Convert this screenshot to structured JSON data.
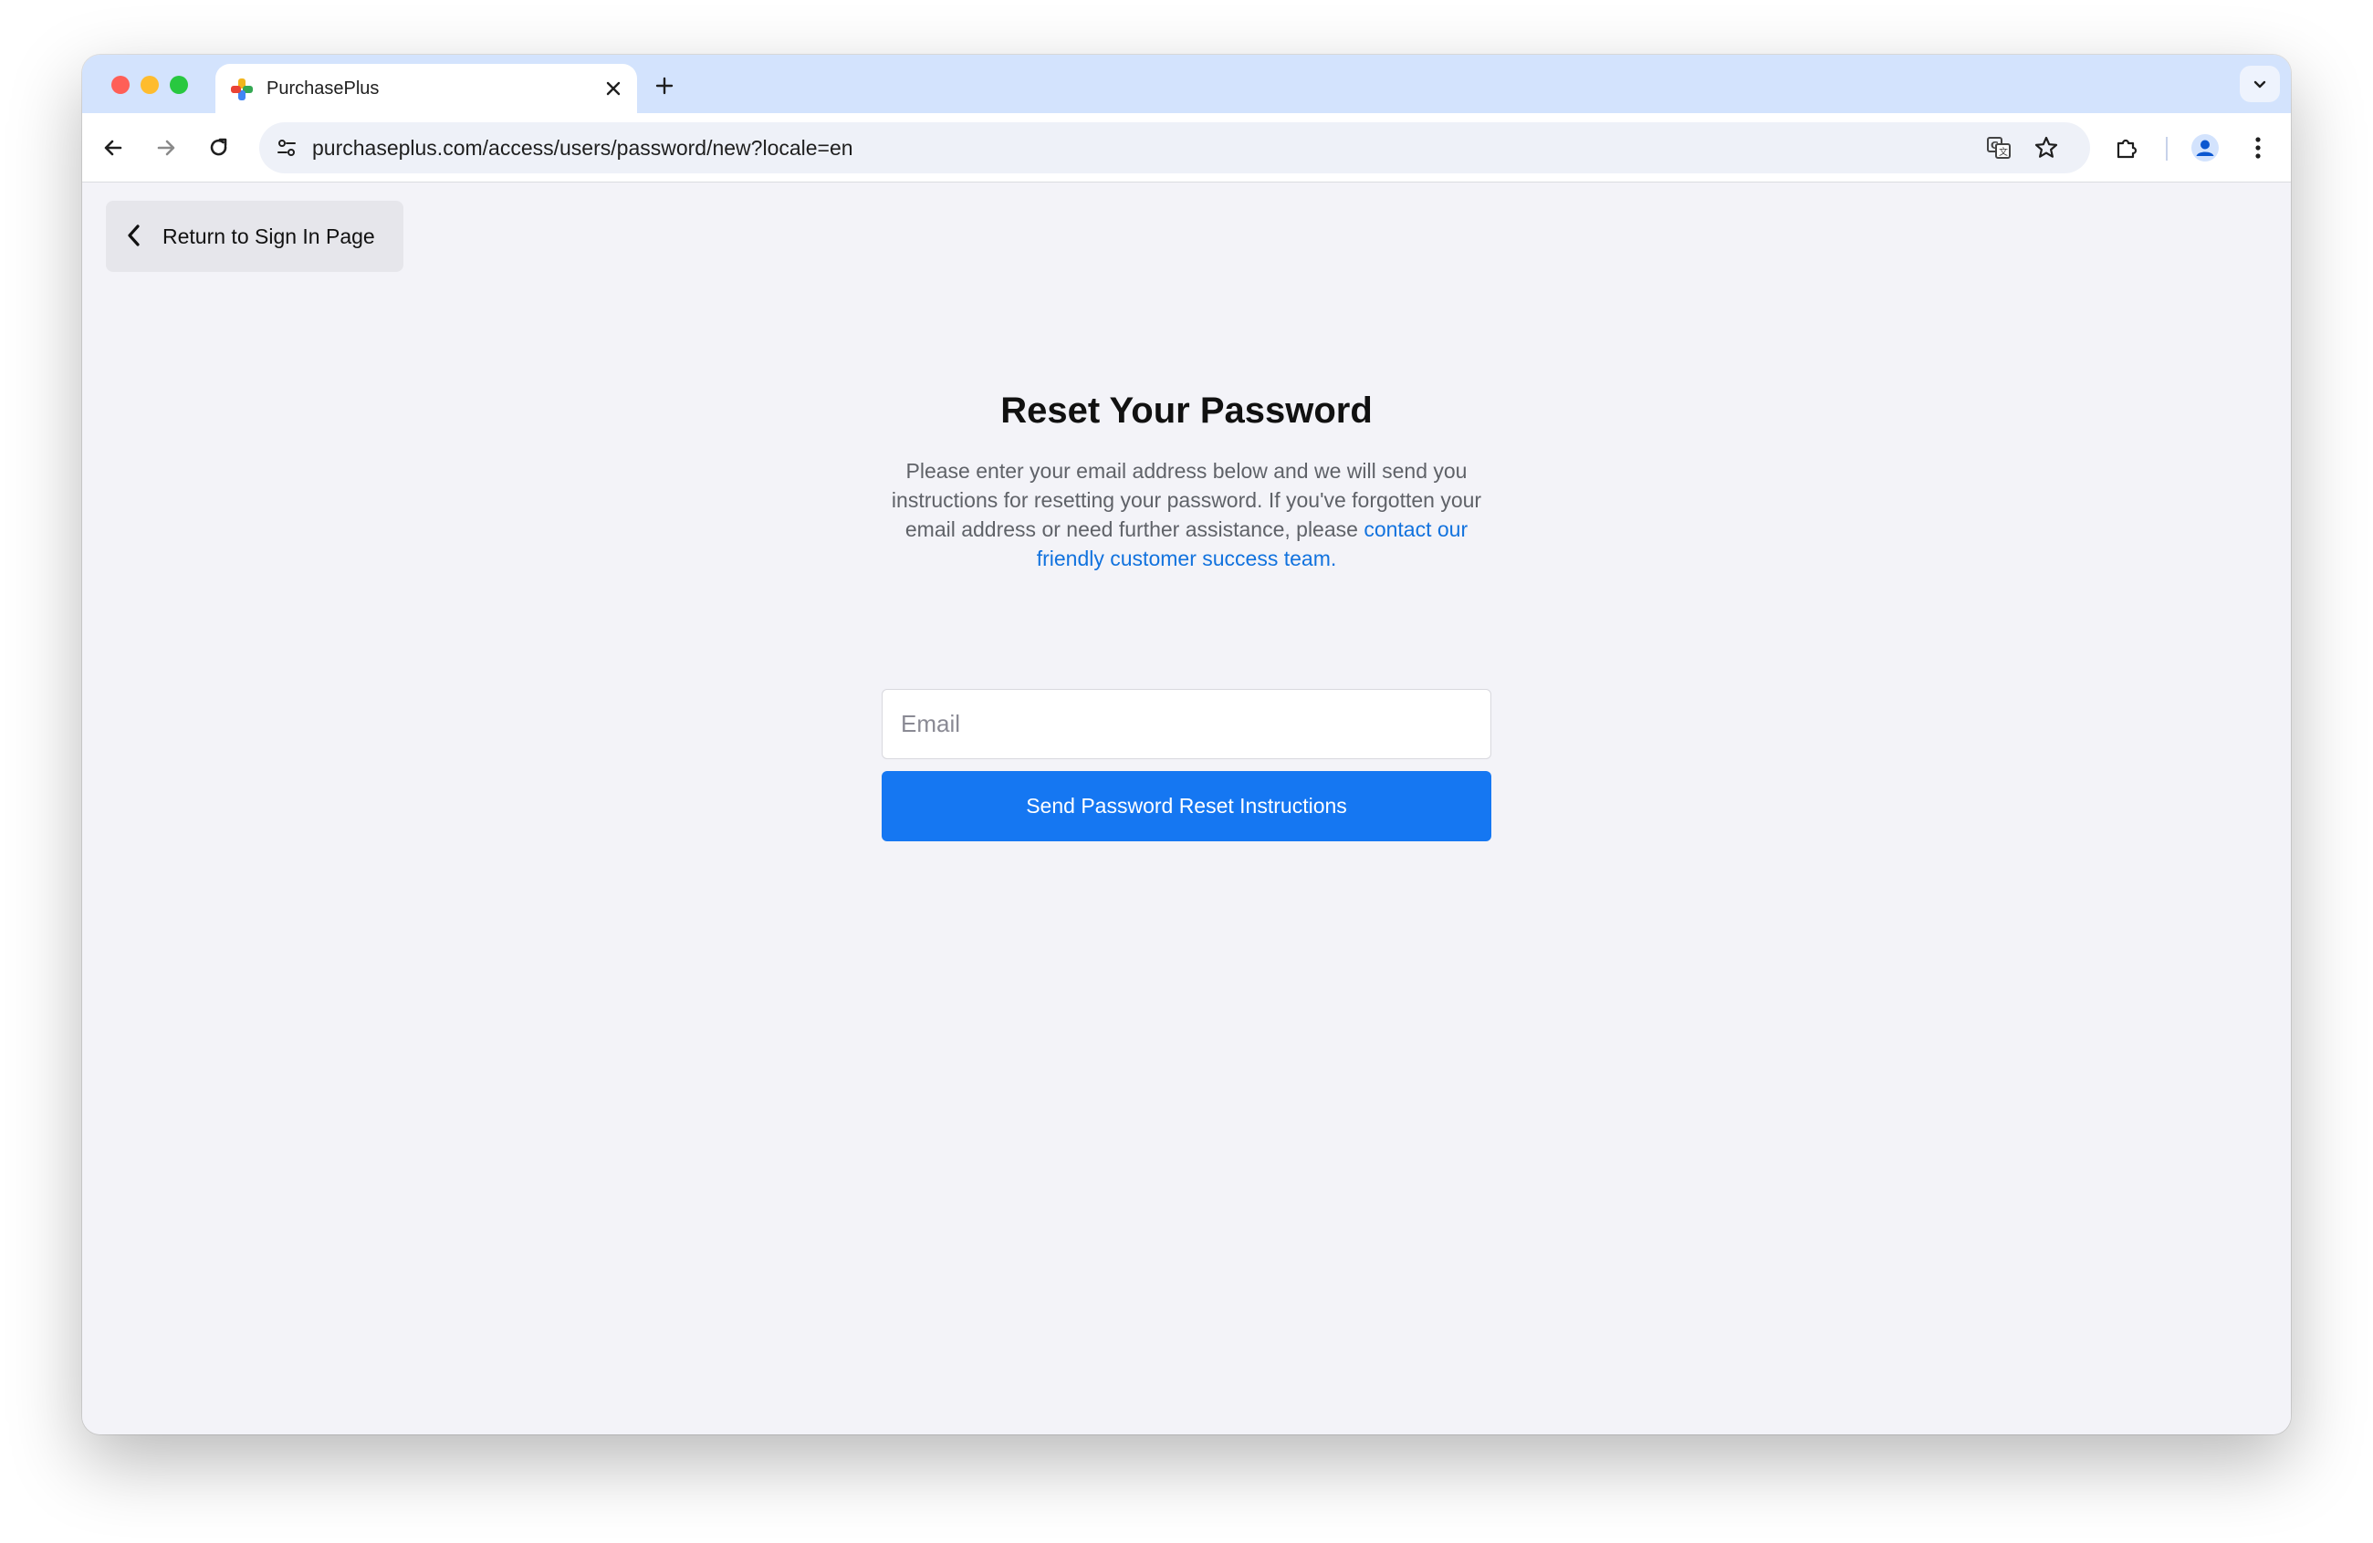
{
  "browser": {
    "tab": {
      "title": "PurchasePlus",
      "favicon": "purchaseplus-logo-icon"
    },
    "address_bar": {
      "url": "purchaseplus.com/access/users/password/new?locale=en"
    },
    "icons": {
      "back": "arrow-left-icon",
      "forward": "arrow-right-icon",
      "reload": "reload-icon",
      "site_info": "tune-icon",
      "translate": "translate-icon",
      "bookmark": "star-icon",
      "extensions": "puzzle-icon",
      "profile": "avatar-icon",
      "menu": "kebab-menu-icon"
    }
  },
  "page": {
    "back_button": {
      "label": "Return to Sign In Page"
    },
    "reset": {
      "title": "Reset Your Password",
      "description": "Please enter your email address below and we will send you instructions for resetting your password. If you've forgotten your email address or need further assistance, please ",
      "contact_link": "contact our friendly customer success team.",
      "email_placeholder": "Email",
      "submit_label": "Send Password Reset Instructions"
    }
  },
  "colors": {
    "tab_strip": "#d3e3fd",
    "page_background": "#f3f3f8",
    "primary_button": "#1577f2",
    "link": "#1172de"
  }
}
